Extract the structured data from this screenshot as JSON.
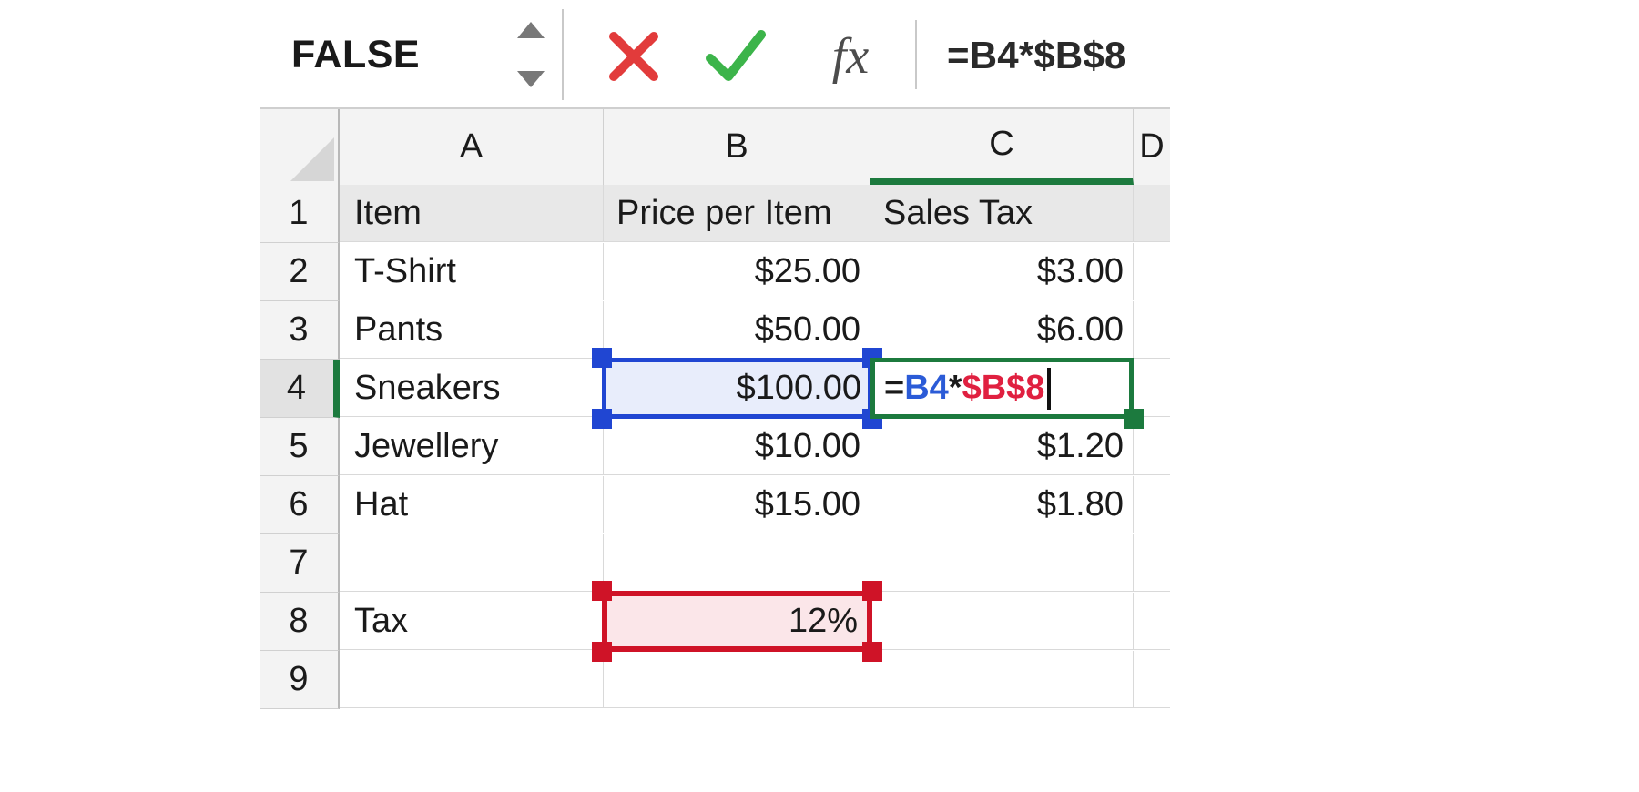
{
  "formula_bar": {
    "name_box_value": "FALSE",
    "spinner_up_icon": "triangle-up-icon",
    "spinner_down_icon": "triangle-down-icon",
    "cancel_icon": "cancel-x-icon",
    "cancel_label": "✕",
    "enter_icon": "enter-check-icon",
    "enter_label": "✓",
    "insert_function_icon": "fx-icon",
    "insert_function_label": "fx",
    "formula_value": "=B4*$B$8"
  },
  "grid": {
    "select_all_icon": "select-all-triangle-icon",
    "column_headers": [
      "A",
      "B",
      "C",
      "D"
    ],
    "active_column": "C",
    "active_row": "4",
    "row_headers": [
      "1",
      "2",
      "3",
      "4",
      "5",
      "6",
      "7",
      "8",
      "9"
    ],
    "rows": [
      {
        "num": "1",
        "a": "Item",
        "b": "Price per Item",
        "c": "Sales Tax",
        "d": ""
      },
      {
        "num": "2",
        "a": "T-Shirt",
        "b": "$25.00",
        "c": "$3.00",
        "d": ""
      },
      {
        "num": "3",
        "a": "Pants",
        "b": "$50.00",
        "c": "$6.00",
        "d": ""
      },
      {
        "num": "4",
        "a": "Sneakers",
        "b": "$100.00",
        "c": "",
        "d": ""
      },
      {
        "num": "5",
        "a": "Jewellery",
        "b": "$10.00",
        "c": "$1.20",
        "d": ""
      },
      {
        "num": "6",
        "a": "Hat",
        "b": "$15.00",
        "c": "$1.80",
        "d": ""
      },
      {
        "num": "7",
        "a": "",
        "b": "",
        "c": "",
        "d": ""
      },
      {
        "num": "8",
        "a": "Tax",
        "b": "12%",
        "c": "",
        "d": ""
      },
      {
        "num": "9",
        "a": "",
        "b": "",
        "c": "",
        "d": ""
      }
    ]
  },
  "editing_cell": {
    "address": "C4",
    "formula_parts": {
      "equals": "=",
      "ref_relative": "B4",
      "operator": "*",
      "ref_absolute": "$B$8"
    },
    "full_text": "=B4*$B$8"
  },
  "references": {
    "relative": {
      "cell": "B4",
      "value": "$100.00",
      "color": "#2046d2",
      "fill": "#e8edfb"
    },
    "absolute": {
      "cell": "B8",
      "value": "12%",
      "color": "#cf1327",
      "fill": "#fbe6e9"
    }
  },
  "colors": {
    "active_green": "#1c7a3e",
    "reference_blue": "#2046d2",
    "reference_red": "#cf1327",
    "header_grey": "#f3f3f3",
    "cancel_red": "#e23b3b",
    "enter_green": "#3cb44a"
  }
}
